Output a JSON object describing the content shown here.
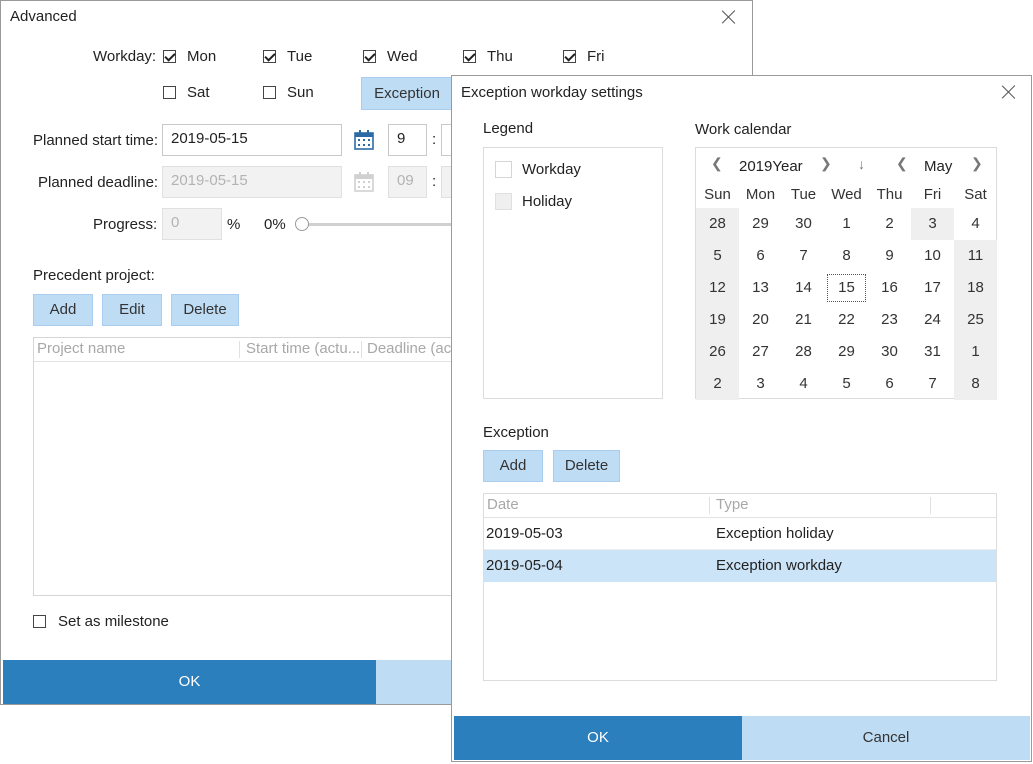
{
  "advanced": {
    "title": "Advanced",
    "workday_label": "Workday:",
    "days": [
      {
        "label": "Mon",
        "checked": true
      },
      {
        "label": "Tue",
        "checked": true
      },
      {
        "label": "Wed",
        "checked": true
      },
      {
        "label": "Thu",
        "checked": true
      },
      {
        "label": "Fri",
        "checked": true
      },
      {
        "label": "Sat",
        "checked": false
      },
      {
        "label": "Sun",
        "checked": false
      }
    ],
    "exception_button": "Exception",
    "planned_start_label": "Planned start time:",
    "planned_start_date": "2019-05-15",
    "planned_start_hour": "9",
    "planned_deadline_label": "Planned deadline:",
    "planned_deadline_date": "2019-05-15",
    "planned_deadline_hour": "09",
    "colon": ":",
    "progress_label": "Progress:",
    "progress_value": "0",
    "percent_sign": "%",
    "progress_slider_text": "0%",
    "progress_fraction": 0,
    "precedent_label": "Precedent project:",
    "add": "Add",
    "edit": "Edit",
    "delete": "Delete",
    "columns": [
      "Project name",
      "Start time (actu...",
      "Deadline (ac"
    ],
    "milestone_label": "Set as milestone",
    "ok": "OK"
  },
  "exception_dialog": {
    "title": "Exception workday settings",
    "legend_label": "Legend",
    "legend_items": [
      {
        "label": "Workday",
        "color": "#ffffff"
      },
      {
        "label": "Holiday",
        "color": "#efefef"
      }
    ],
    "work_calendar_label": "Work calendar",
    "year": "2019Year",
    "month": "May",
    "weekdays": [
      "Sun",
      "Mon",
      "Tue",
      "Wed",
      "Thu",
      "Fri",
      "Sat"
    ],
    "weeks": [
      [
        "28",
        "29",
        "30",
        "1",
        "2",
        "3",
        "4"
      ],
      [
        "5",
        "6",
        "7",
        "8",
        "9",
        "10",
        "11"
      ],
      [
        "12",
        "13",
        "14",
        "15",
        "16",
        "17",
        "18"
      ],
      [
        "19",
        "20",
        "21",
        "22",
        "23",
        "24",
        "25"
      ],
      [
        "26",
        "27",
        "28",
        "29",
        "30",
        "31",
        "1"
      ],
      [
        "2",
        "3",
        "4",
        "5",
        "6",
        "7",
        "8"
      ]
    ],
    "selected_day": "15",
    "exception_label": "Exception",
    "add": "Add",
    "delete": "Delete",
    "columns": [
      "Date",
      "Type"
    ],
    "rows": [
      {
        "date": "2019-05-03",
        "type": "Exception holiday",
        "selected": false
      },
      {
        "date": "2019-05-04",
        "type": "Exception workday",
        "selected": true
      }
    ],
    "ok": "OK",
    "cancel": "Cancel",
    "holiday_color": "#efefef",
    "selected_row_color": "#cce4f7",
    "primary_color": "#2c7fbd"
  }
}
